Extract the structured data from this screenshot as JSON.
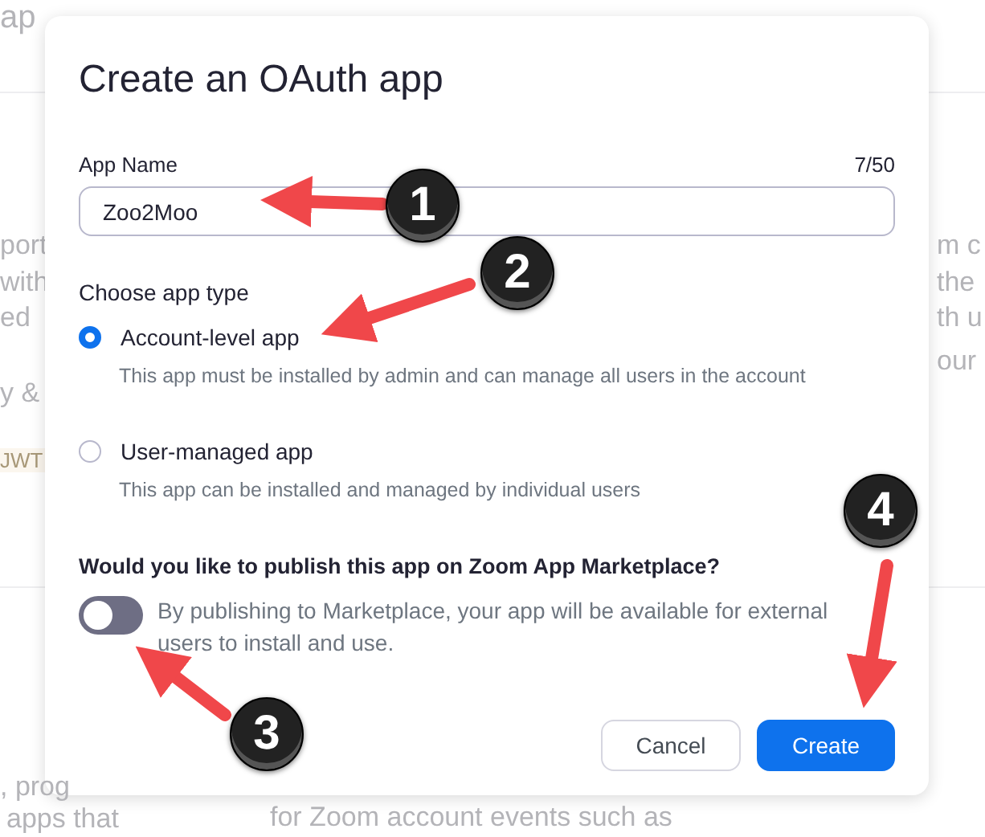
{
  "background": {
    "texts": [
      "ap",
      "port",
      "with",
      "ed",
      "y &",
      "JWT",
      ", prog",
      "apps that",
      "for Zoom account events such as",
      "m c",
      "the",
      "th u",
      "our"
    ]
  },
  "dialog": {
    "title": "Create an OAuth app",
    "name_field": {
      "label": "App Name",
      "counter": "7/50",
      "value": "Zoo2Moo"
    },
    "app_type": {
      "label": "Choose app type",
      "options": [
        {
          "label": "Account-level app",
          "description": "This app must be installed by admin and can manage all users in the account",
          "selected": true
        },
        {
          "label": "User-managed app",
          "description": "This app can be installed and managed by individual users",
          "selected": false
        }
      ]
    },
    "publish": {
      "question": "Would you like to publish this app on Zoom App Marketplace?",
      "on": false,
      "description": "By publishing to Marketplace, your app will be available for external users to install and use."
    },
    "buttons": [
      {
        "label": "Cancel",
        "kind": "secondary"
      },
      {
        "label": "Create",
        "kind": "primary"
      }
    ]
  },
  "annotations": [
    {
      "label": "1"
    },
    {
      "label": "2"
    },
    {
      "label": "3"
    },
    {
      "label": "4"
    }
  ]
}
